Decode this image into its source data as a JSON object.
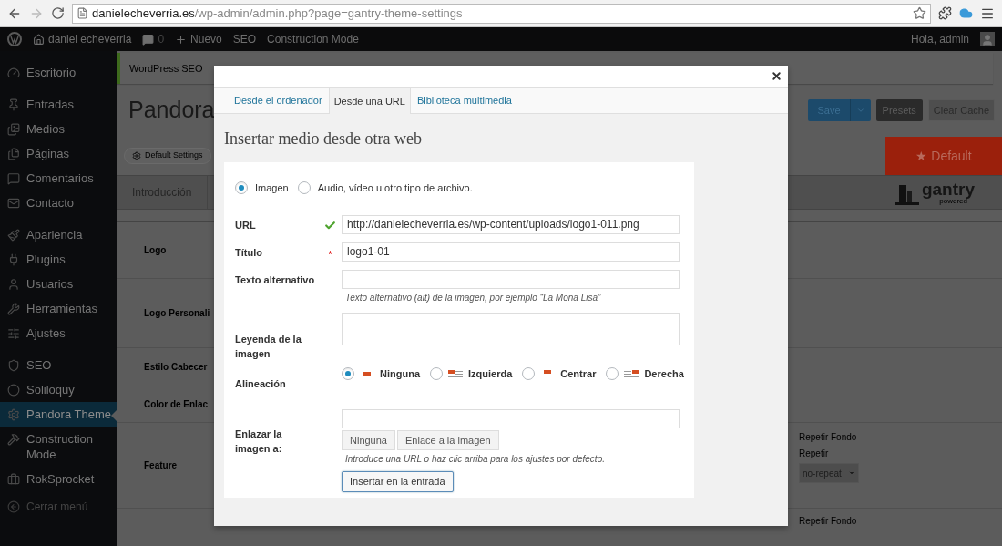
{
  "browser": {
    "url_domain": "danielecheverria.es",
    "url_path": "/wp-admin/admin.php?page=gantry-theme-settings"
  },
  "admin_bar": {
    "site": "daniel echeverria",
    "comments": "0",
    "new": "Nuevo",
    "items": [
      "SEO",
      "Construction Mode"
    ],
    "greeting": "Hola, admin"
  },
  "sidebar": {
    "groups": [
      {
        "items": [
          {
            "label": "Escritorio",
            "selected": false
          }
        ]
      },
      {
        "items": [
          {
            "label": "Entradas",
            "selected": false
          },
          {
            "label": "Medios",
            "selected": false
          },
          {
            "label": "Páginas",
            "selected": false
          },
          {
            "label": "Comentarios",
            "selected": false
          },
          {
            "label": "Contacto",
            "selected": false
          }
        ]
      },
      {
        "items": [
          {
            "label": "Apariencia",
            "selected": false
          },
          {
            "label": "Plugins",
            "selected": false
          },
          {
            "label": "Usuarios",
            "selected": false
          },
          {
            "label": "Herramientas",
            "selected": false
          },
          {
            "label": "Ajustes",
            "selected": false
          }
        ]
      },
      {
        "items": [
          {
            "label": "SEO",
            "selected": false
          },
          {
            "label": "Soliloquy",
            "selected": false
          },
          {
            "label": "Pandora Theme",
            "selected": true
          },
          {
            "label": "Construction Mode",
            "selected": false
          },
          {
            "label": "RokSprocket",
            "selected": false
          }
        ]
      }
    ],
    "collapse": "Cerrar menú"
  },
  "page": {
    "notice": "WordPress SEO",
    "title": "Pandora",
    "buttons": {
      "save": "Save",
      "presets": "Presets",
      "clear_cache": "Clear Cache"
    },
    "default_settings": "Default Settings",
    "preset_banner": "★ Default",
    "tab": "Introducción",
    "logo": {
      "name": "gantry",
      "tagline": "powered"
    },
    "rows": [
      {
        "label": "Logo"
      },
      {
        "label": "Logo Personali"
      },
      {
        "label": "Estilo Cabecer"
      },
      {
        "label": "Color de Enlac"
      },
      {
        "label": "Feature",
        "side": {
          "heading": "Repetir Fondo",
          "label": "Repetir",
          "select": "no-repeat"
        }
      }
    ],
    "bottom_row": {
      "heading": "Repetir Fondo"
    }
  },
  "modal": {
    "tabs": [
      {
        "label": "Desde el ordenador",
        "selected": false
      },
      {
        "label": "Desde una URL",
        "selected": true
      },
      {
        "label": "Biblioteca multimedia",
        "selected": false
      }
    ],
    "heading": "Insertar medio desde otra web",
    "media_type": [
      {
        "label": "Imagen",
        "selected": true
      },
      {
        "label": "Audio, vídeo u otro tipo de archivo.",
        "selected": false
      }
    ],
    "fields": [
      {
        "kind": "text",
        "label": "URL",
        "validated": true,
        "value": "http://danielecheverria.es/wp-content/uploads/logo1-011.png"
      },
      {
        "kind": "text",
        "label": "Título",
        "marker": "*",
        "value": "logo1-01"
      },
      {
        "kind": "text",
        "label": "Texto alternativo",
        "hint": "Texto alternativo (alt) de la imagen, por ejemplo “La Mona Lisa”"
      },
      {
        "kind": "textarea",
        "label": "Leyenda de la imagen"
      },
      {
        "kind": "radios",
        "label": "Alineación",
        "options": [
          {
            "label": "Ninguna",
            "selected": true
          },
          {
            "label": "Izquierda",
            "selected": false
          },
          {
            "label": "Centrar",
            "selected": false
          },
          {
            "label": "Derecha",
            "selected": false
          }
        ]
      },
      {
        "kind": "link",
        "label": "Enlazar la imagen a:",
        "buttons": [
          "Ninguna",
          "Enlace a la imagen"
        ],
        "hint": "Introduce una URL o haz clic arriba para los ajustes por defecto."
      }
    ],
    "submit": "Insertar en la entrada"
  }
}
